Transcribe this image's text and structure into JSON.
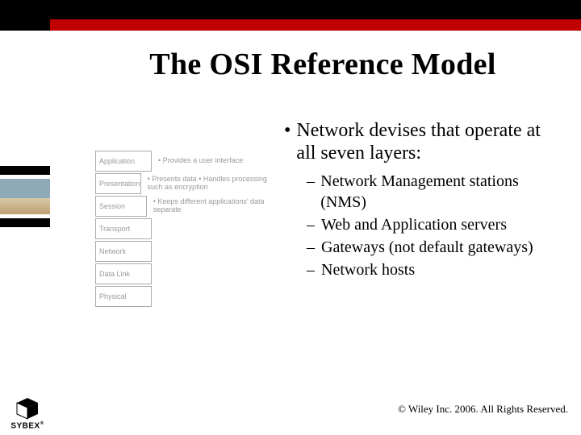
{
  "title": "The OSI Reference Model",
  "main_bullet": "Network devises that operate at all seven layers:",
  "sub_bullets": [
    "Network Management stations (NMS)",
    "Web and Application servers",
    "Gateways (not default gateways)",
    "Network hosts"
  ],
  "osi_layers": [
    {
      "name": "Application",
      "desc": "• Provides a user interface"
    },
    {
      "name": "Presentation",
      "desc": "• Presents data\n• Handles processing such as encryption"
    },
    {
      "name": "Session",
      "desc": "• Keeps different applications' data separate"
    },
    {
      "name": "Transport",
      "desc": ""
    },
    {
      "name": "Network",
      "desc": ""
    },
    {
      "name": "Data Link",
      "desc": ""
    },
    {
      "name": "Physical",
      "desc": ""
    }
  ],
  "footer": "© Wiley Inc. 2006. All Rights Reserved.",
  "logo_text": "SYBEX"
}
